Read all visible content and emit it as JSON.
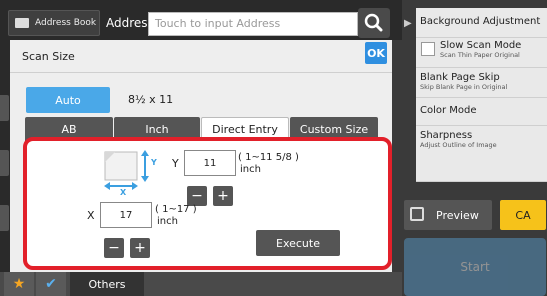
{
  "topbar": {
    "address_book_label": "Address Book",
    "address_label": "Address",
    "address_placeholder": "Touch to input Address"
  },
  "panel": {
    "title": "Scan Size",
    "ok_label": "OK",
    "auto_label": "Auto",
    "detected_size": "8½ x 11",
    "tabs": [
      {
        "label": "AB",
        "active": false
      },
      {
        "label": "Inch",
        "active": false
      },
      {
        "label": "Direct Entry",
        "active": true
      },
      {
        "label": "Custom Size",
        "active": false
      }
    ],
    "y": {
      "label": "Y",
      "value": "11",
      "range": "( 1~11 5/8 )",
      "unit": "inch"
    },
    "x": {
      "label": "X",
      "value": "17",
      "range": "( 1~17 )",
      "unit": "inch"
    },
    "minus": "−",
    "plus": "+",
    "execute_label": "Execute",
    "diagram_y": "Y",
    "diagram_x": "X"
  },
  "right_menu": {
    "items": [
      {
        "title": "Background Adjustment",
        "sub": ""
      },
      {
        "title": "Slow Scan Mode",
        "sub": "Scan Thin Paper Original"
      },
      {
        "title": "Blank Page Skip",
        "sub": "Skip Blank Page in Original"
      },
      {
        "title": "Color Mode",
        "sub": ""
      },
      {
        "title": "Sharpness",
        "sub": "Adjust Outline of Image"
      }
    ],
    "preview_label": "Preview",
    "ca_label": "CA",
    "start_label": "Start"
  },
  "bottombar": {
    "others_label": "Others"
  },
  "colors": {
    "accent_blue": "#4aa8e8",
    "highlight_red": "#e2202a",
    "ca_yellow": "#f6c21a"
  }
}
